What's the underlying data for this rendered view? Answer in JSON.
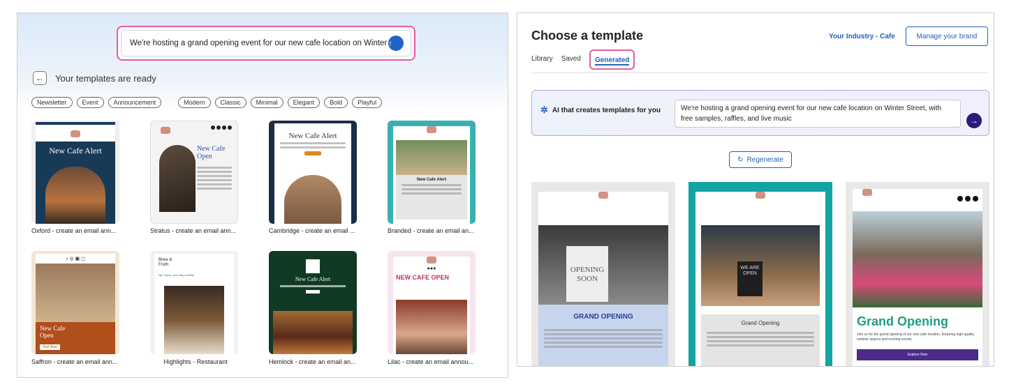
{
  "left": {
    "prompt": "We're hosting a grand opening event for our new cafe location on Winter Street,",
    "heading": "Your templates are ready",
    "chips_type": [
      "Newsletter",
      "Event",
      "Announcement"
    ],
    "chips_style": [
      "Modern",
      "Classic",
      "Minimal",
      "Elegant",
      "Bold",
      "Playful"
    ],
    "templates": [
      {
        "label": "Oxford - create an email ann...",
        "headline": "New Cafe Alert"
      },
      {
        "label": "Stratus - create an email ann...",
        "headline": "New Cafe Open"
      },
      {
        "label": "Cambridge - create an email ...",
        "headline": "New Cafe Alert"
      },
      {
        "label": "Branded - create an email an...",
        "headline": "New Cafe Alert"
      },
      {
        "label": "Saffron - create an email ann...",
        "headline": "New Cafe Open",
        "cta": "Visit Now"
      },
      {
        "label": "Highlights - Restaurant",
        "headline": "Brew & Froth",
        "subline": "Sip, Savor, and Stay a While"
      },
      {
        "label": "Hemlock - create an email an...",
        "headline": "New Cafe Alert"
      },
      {
        "label": "Lilac - create an email annou...",
        "headline": "NEW CAFE OPEN"
      }
    ]
  },
  "right": {
    "title": "Choose a template",
    "industry_link": "Your Industry - Cafe",
    "manage_button": "Manage your brand",
    "tabs": [
      "Library",
      "Saved",
      "Generated"
    ],
    "ai_label": "AI that creates templates for you",
    "ai_prompt": "We're hosting a grand opening event for our new cafe location on Winter Street, with free samples, raffles, and live music",
    "regenerate": "Regenerate",
    "generated": [
      {
        "heading": "GRAND OPENING",
        "sign": "OPENING SOON"
      },
      {
        "heading": "Grand Opening",
        "sign": "WE ARE OPEN"
      },
      {
        "heading": "Grand Opening",
        "blurb": "Join us for the grand opening of our new cafe location, featuring high-quality outdoor spaces and exciting events.",
        "cta": "Explore Now"
      }
    ]
  },
  "colors": {
    "accent": "#1f5fbf",
    "highlight": "#e85b9e",
    "send": "#1f63c6",
    "ai_send": "#2b1c7a",
    "teal": "#13a3a3",
    "grand_green": "#1f9e7f"
  }
}
